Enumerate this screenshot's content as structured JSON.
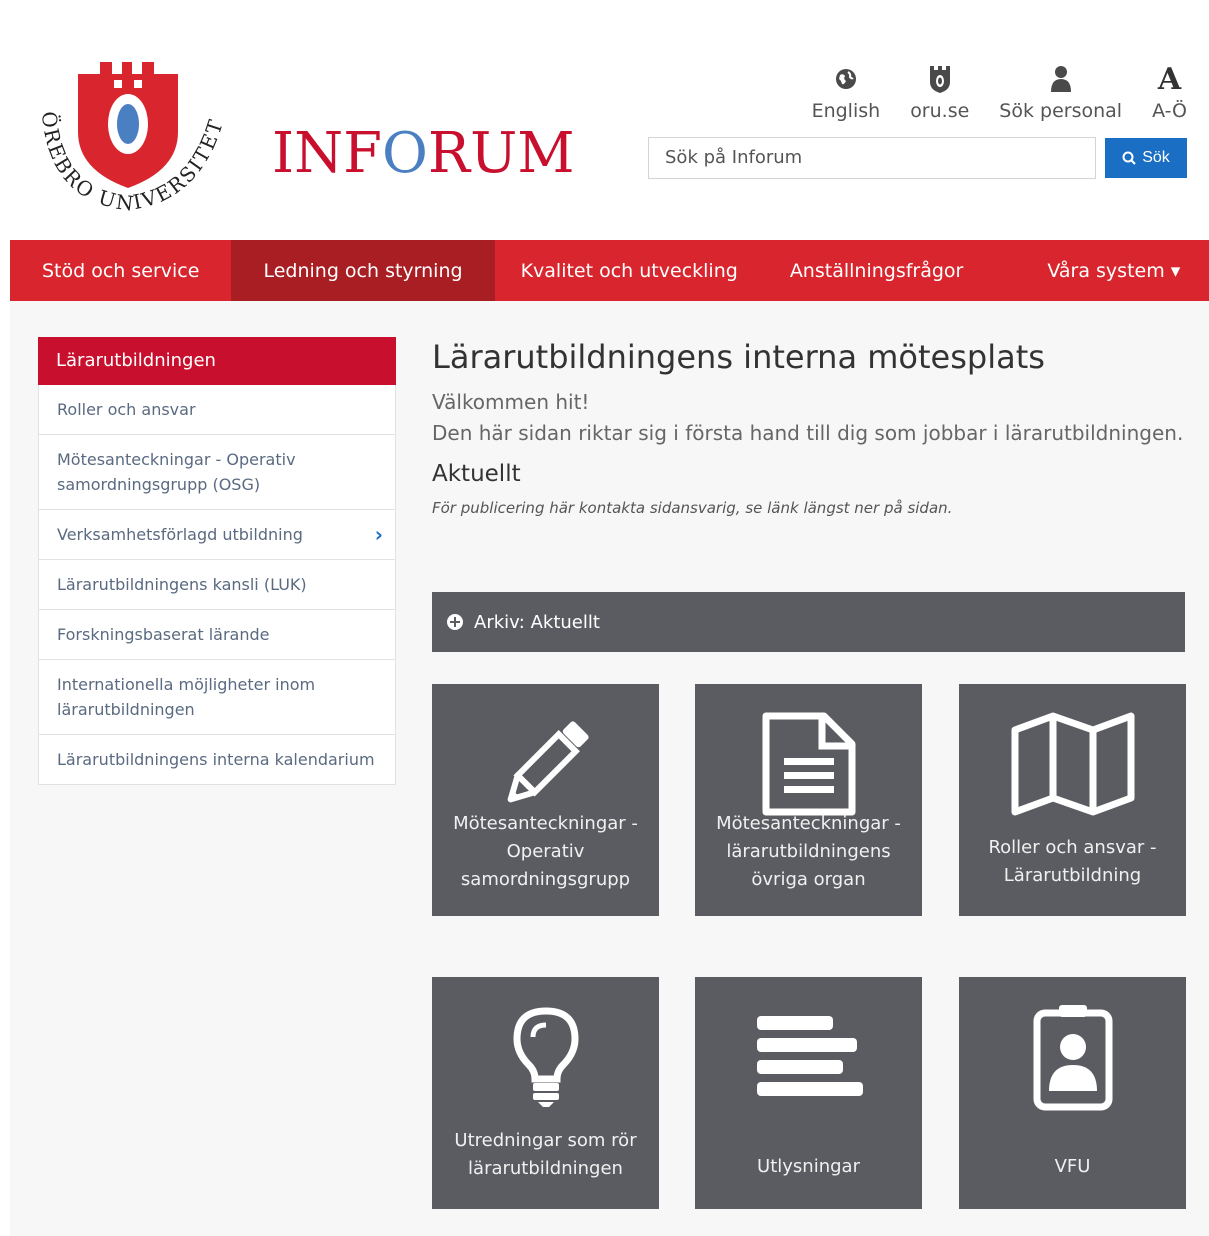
{
  "logo": {
    "ring_text": "ÖREBRO UNIVERSITET",
    "shield_letter": "Ö"
  },
  "brand": {
    "part1": "INF",
    "part2": "O",
    "part3": "RUM"
  },
  "toplinks": [
    {
      "label": "English",
      "icon": "globe-icon"
    },
    {
      "label": "oru.se",
      "icon": "shield-icon"
    },
    {
      "label": "Sök personal",
      "icon": "person-icon"
    },
    {
      "label": "A-Ö",
      "icon": "letter-a-icon",
      "glyph": "A"
    }
  ],
  "search": {
    "placeholder": "Sök på Inforum",
    "button_label": "Sök"
  },
  "nav": [
    {
      "label": "Stöd och service"
    },
    {
      "label": "Ledning och styrning",
      "active": true
    },
    {
      "label": "Kvalitet och utveckling"
    },
    {
      "label": "Anställningsfrågor"
    },
    {
      "label": "Våra system ▾"
    }
  ],
  "sidebar": {
    "heading": "Lärarutbildningen",
    "items": [
      {
        "label": "Roller och ansvar"
      },
      {
        "label": "Mötesanteckningar - Operativ samordningsgrupp (OSG)"
      },
      {
        "label": "Verksamhetsförlagd utbildning",
        "chevron": "›"
      },
      {
        "label": "Lärarutbildningens kansli (LUK)"
      },
      {
        "label": "Forskningsbaserat lärande"
      },
      {
        "label": "Internationella möjligheter inom lärarutbildningen"
      },
      {
        "label": "Lärarutbildningens interna kalendarium"
      }
    ]
  },
  "main": {
    "title": "Lärarutbildningens interna mötesplats",
    "welcome_line1": "Välkommen hit!",
    "welcome_line2": "Den här sidan riktar sig i första hand till dig som jobbar i lärarutbildningen.",
    "subheading": "Aktuellt",
    "note": "För publicering här kontakta sidansvarig, se länk längst ner på sidan.",
    "archive_label": "Arkiv: Aktuellt"
  },
  "tiles": [
    {
      "label": "Mötesanteckningar - Operativ samordningsgrupp",
      "icon": "pencil-icon"
    },
    {
      "label": "Mötesanteckningar - lärarutbildningens övriga organ",
      "icon": "document-icon"
    },
    {
      "label": "Roller och ansvar - Lärarutbildning",
      "icon": "map-icon"
    },
    {
      "label": "Utredningar som rör lärarutbildningen",
      "icon": "lightbulb-icon"
    },
    {
      "label": "Utlysningar",
      "icon": "text-lines-icon"
    },
    {
      "label": "VFU",
      "icon": "badge-icon"
    }
  ],
  "colors": {
    "brand_red": "#d9262e",
    "nav_active": "#a81e23",
    "tile_bg": "#5a5c61",
    "search_button": "#1a6fc4"
  }
}
